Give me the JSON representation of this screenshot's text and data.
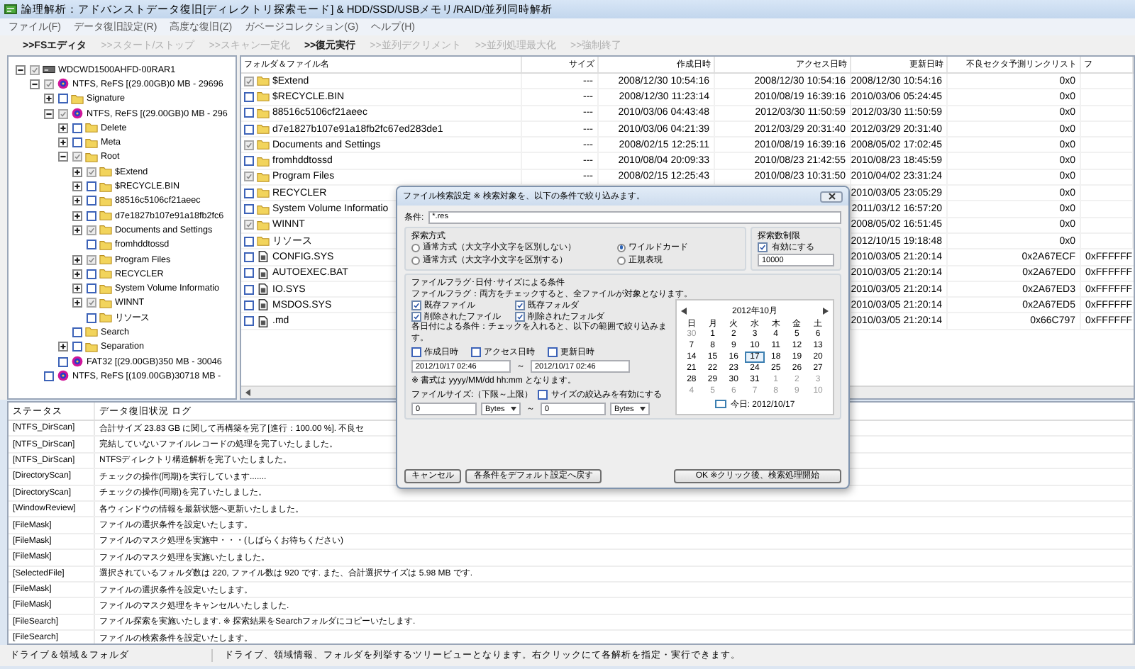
{
  "window": {
    "title": "論理解析：アドバンストデータ復旧[ディレクトリ探索モード] & HDD/SSD/USBメモリ/RAID/並列同時解析"
  },
  "menu": [
    "ファイル(F)",
    "データ復旧設定(R)",
    "高度な復旧(Z)",
    "ガベージコレクション(G)",
    "ヘルプ(H)"
  ],
  "toolbar": [
    {
      "label": ">>FSエディタ",
      "disabled": false
    },
    {
      "label": ">>スタート/ストップ",
      "disabled": true
    },
    {
      "label": ">>スキャン一定化",
      "disabled": true
    },
    {
      "label": ">>復元実行",
      "disabled": false
    },
    {
      "label": ">>並列デクリメント",
      "disabled": true
    },
    {
      "label": ">>並列処理最大化",
      "disabled": true
    },
    {
      "label": ">>強制終了",
      "disabled": true
    }
  ],
  "tree": [
    {
      "label": "WDCWD1500AHFD-00RAR1",
      "kind": "disk",
      "checked": true,
      "expandable": true,
      "expanded": true,
      "children": [
        {
          "label": "NTFS, ReFS [(29.00GB)0 MB - 29696",
          "kind": "partition",
          "checked": true,
          "expandable": true,
          "expanded": true,
          "children": [
            {
              "label": "Signature",
              "kind": "folder",
              "checked": false,
              "expandable": true,
              "expanded": false
            },
            {
              "label": "NTFS, ReFS [(29.00GB)0 MB - 296",
              "kind": "partition",
              "checked": true,
              "expandable": true,
              "expanded": true,
              "children": [
                {
                  "label": "Delete",
                  "kind": "folder",
                  "checked": false,
                  "expandable": true,
                  "expanded": false
                },
                {
                  "label": "Meta",
                  "kind": "folder",
                  "checked": false,
                  "expandable": true,
                  "expanded": false
                },
                {
                  "label": "Root",
                  "kind": "folder",
                  "checked": true,
                  "expandable": true,
                  "expanded": true,
                  "children": [
                    {
                      "label": "$Extend",
                      "kind": "folder",
                      "checked": true,
                      "expandable": true,
                      "expanded": false
                    },
                    {
                      "label": "$RECYCLE.BIN",
                      "kind": "folder",
                      "checked": false,
                      "expandable": true,
                      "expanded": false
                    },
                    {
                      "label": "88516c5106cf21aeec",
                      "kind": "folder",
                      "checked": false,
                      "expandable": true,
                      "expanded": false
                    },
                    {
                      "label": "d7e1827b107e91a18fb2fc6",
                      "kind": "folder",
                      "checked": false,
                      "expandable": true,
                      "expanded": false
                    },
                    {
                      "label": "Documents and Settings",
                      "kind": "folder",
                      "checked": true,
                      "expandable": true,
                      "expanded": false
                    },
                    {
                      "label": "fromhddtossd",
                      "kind": "folder",
                      "checked": false,
                      "expandable": false
                    },
                    {
                      "label": "Program Files",
                      "kind": "folder",
                      "checked": true,
                      "expandable": true,
                      "expanded": false
                    },
                    {
                      "label": "RECYCLER",
                      "kind": "folder",
                      "checked": false,
                      "expandable": true,
                      "expanded": false
                    },
                    {
                      "label": "System Volume Informatio",
                      "kind": "folder",
                      "checked": false,
                      "expandable": true,
                      "expanded": false
                    },
                    {
                      "label": "WINNT",
                      "kind": "folder",
                      "checked": true,
                      "expandable": true,
                      "expanded": false
                    },
                    {
                      "label": "リソース",
                      "kind": "folder",
                      "checked": false,
                      "expandable": false
                    }
                  ]
                },
                {
                  "label": "Search",
                  "kind": "folder",
                  "checked": false,
                  "expandable": false
                },
                {
                  "label": "Separation",
                  "kind": "folder",
                  "checked": false,
                  "expandable": true,
                  "expanded": false
                }
              ]
            },
            {
              "label": "FAT32 [(29.00GB)350 MB - 30046",
              "kind": "partition",
              "checked": false,
              "expandable": false
            }
          ]
        },
        {
          "label": "NTFS, ReFS [(109.00GB)30718 MB -",
          "kind": "partition",
          "checked": false,
          "expandable": false
        }
      ]
    }
  ],
  "file_list": {
    "columns": [
      "フォルダ＆ファイル名",
      "サイズ",
      "作成日時",
      "アクセス日時",
      "更新日時",
      "不良セクタ予測リンクリスト",
      "フ"
    ],
    "rows": [
      {
        "kind": "folder",
        "checked": true,
        "name": "$Extend",
        "size": "---",
        "created": "2008/12/30 10:54:16",
        "accessed": "2008/12/30 10:54:16",
        "modified": "2008/12/30 10:54:16",
        "link_list": "0x0"
      },
      {
        "kind": "folder",
        "checked": false,
        "name": "$RECYCLE.BIN",
        "size": "---",
        "created": "2008/12/30 11:23:14",
        "accessed": "2010/08/19 16:39:16",
        "modified": "2010/03/06 05:24:45",
        "link_list": "0x0"
      },
      {
        "kind": "folder",
        "checked": false,
        "name": "88516c5106cf21aeec",
        "size": "---",
        "created": "2010/03/06 04:43:48",
        "accessed": "2012/03/30 11:50:59",
        "modified": "2012/03/30 11:50:59",
        "link_list": "0x0"
      },
      {
        "kind": "folder",
        "checked": false,
        "name": "d7e1827b107e91a18fb2fc67ed283de1",
        "size": "---",
        "created": "2010/03/06 04:21:39",
        "accessed": "2012/03/29 20:31:40",
        "modified": "2012/03/29 20:31:40",
        "link_list": "0x0"
      },
      {
        "kind": "folder",
        "checked": true,
        "name": "Documents and Settings",
        "size": "---",
        "created": "2008/02/15 12:25:11",
        "accessed": "2010/08/19 16:39:16",
        "modified": "2008/05/02 17:02:45",
        "link_list": "0x0"
      },
      {
        "kind": "folder",
        "checked": false,
        "name": "fromhddtossd",
        "size": "---",
        "created": "2010/08/04 20:09:33",
        "accessed": "2010/08/23 21:42:55",
        "modified": "2010/08/23 18:45:59",
        "link_list": "0x0"
      },
      {
        "kind": "folder",
        "checked": true,
        "name": "Program Files",
        "size": "---",
        "created": "2008/02/15 12:25:43",
        "accessed": "2010/08/23 10:31:50",
        "modified": "2010/04/02 23:31:24",
        "link_list": "0x0"
      },
      {
        "kind": "folder",
        "checked": false,
        "name": "RECYCLER",
        "modified": "2010/03/05 23:05:29",
        "link_list": "0x0"
      },
      {
        "kind": "folder",
        "checked": false,
        "name": "System Volume Informatio",
        "modified": "2011/03/12 16:57:20",
        "link_list": "0x0"
      },
      {
        "kind": "folder",
        "checked": true,
        "name": "WINNT",
        "modified": "2008/05/02 16:51:45",
        "link_list": "0x0"
      },
      {
        "kind": "folder",
        "checked": false,
        "name": "リソース",
        "modified": "2012/10/15 19:18:48",
        "link_list": "0x0"
      },
      {
        "kind": "file",
        "checked": false,
        "name": "CONFIG.SYS",
        "modified": "2010/03/05 21:20:14",
        "link_list": "0x2A67ECF",
        "column_7": "0xFFFFFF"
      },
      {
        "kind": "file",
        "checked": false,
        "name": "AUTOEXEC.BAT",
        "modified": "2010/03/05 21:20:14",
        "link_list": "0x2A67ED0",
        "column_7": "0xFFFFFF"
      },
      {
        "kind": "file",
        "checked": false,
        "name": "IO.SYS",
        "modified": "2010/03/05 21:20:14",
        "link_list": "0x2A67ED3",
        "column_7": "0xFFFFFF"
      },
      {
        "kind": "file",
        "checked": false,
        "name": "MSDOS.SYS",
        "modified": "2010/03/05 21:20:14",
        "link_list": "0x2A67ED5",
        "column_7": "0xFFFFFF"
      },
      {
        "kind": "file",
        "checked": false,
        "name": ".md",
        "modified": "2010/03/05 21:20:14",
        "link_list": "0x66C797",
        "column_7": "0xFFFFFF"
      }
    ]
  },
  "log": {
    "columns": [
      "ステータス",
      "データ復旧状況 ログ"
    ],
    "rows": [
      {
        "status": "[NTFS_DirScan]",
        "message": "合計サイズ 23.83 GB に関して再構築を完了[進行：100.00 %]. 不良セ"
      },
      {
        "status": "[NTFS_DirScan]",
        "message": "完結していないファイルレコードの処理を完了いたしました。"
      },
      {
        "status": "[NTFS_DirScan]",
        "message": "NTFSディレクトリ構造解析を完了いたしました。"
      },
      {
        "status": "[DirectoryScan]",
        "message": "チェックの操作(同期)を実行しています......."
      },
      {
        "status": "[DirectoryScan]",
        "message": "チェックの操作(同期)を完了いたしました。"
      },
      {
        "status": "[WindowReview]",
        "message": "各ウィンドウの情報を最新状態へ更新いたしました。"
      },
      {
        "status": "[FileMask]",
        "message": "ファイルの選択条件を設定いたします。"
      },
      {
        "status": "[FileMask]",
        "message": "ファイルのマスク処理を実施中・・・(しばらくお待ちください)"
      },
      {
        "status": "[FileMask]",
        "message": "ファイルのマスク処理を実施いたしました。"
      },
      {
        "status": "[SelectedFile]",
        "message": "選択されているフォルダ数は 220, ファイル数は 920 です. また、合計選択サイズは 5.98 MB です."
      },
      {
        "status": "[FileMask]",
        "message": "ファイルの選択条件を設定いたします。"
      },
      {
        "status": "[FileMask]",
        "message": "ファイルのマスク処理をキャンセルいたしました."
      },
      {
        "status": "[FileSearch]",
        "message": "ファイル探索を実施いたします. ※ 探索結果をSearchフォルダにコピーいたします."
      },
      {
        "status": "[FileSearch]",
        "message": "ファイルの検索条件を設定いたします。"
      }
    ]
  },
  "status_bar": {
    "section": "ドライブ＆領域＆フォルダ",
    "text": "ドライブ、領域情報、フォルダを列挙するツリービューとなります。右クリックにて各解析を指定・実行できます。"
  },
  "dialog": {
    "title": "ファイル検索設定 ※ 検索対象を、以下の条件で絞り込みます。",
    "condition": {
      "label": "条件:",
      "value": "*.res"
    },
    "search_method": {
      "title": "探索方式",
      "options": [
        {
          "label": "通常方式（大文字小文字を区別しない）",
          "selected": false
        },
        {
          "label": "通常方式（大文字小文字を区別する）",
          "selected": false
        },
        {
          "label": "ワイルドカード",
          "selected": true
        },
        {
          "label": "正規表現",
          "selected": false
        }
      ]
    },
    "limit": {
      "title": "探索数制限",
      "label": "有効にする",
      "checked": true,
      "value": "10000"
    },
    "filters": {
      "title": "ファイルフラグ･日付･サイズによる条件",
      "flag_note": "ファイルフラグ：両方をチェックすると、全ファイルが対象となります。",
      "flags": [
        {
          "label": "既存ファイル",
          "checked": true
        },
        {
          "label": "削除されたファイル",
          "checked": true
        },
        {
          "label": "既存フォルダ",
          "checked": true
        },
        {
          "label": "削除されたフォルダ",
          "checked": true
        }
      ],
      "date_note": "各日付による条件：チェックを入れると、以下の範囲で絞り込みます。",
      "date_types": [
        {
          "label": "作成日時",
          "checked": false
        },
        {
          "label": "アクセス日時",
          "checked": false
        },
        {
          "label": "更新日時",
          "checked": false
        }
      ],
      "date_from": "2012/10/17 02:46",
      "date_separator": "～",
      "date_to": "2012/10/17 02:46",
      "format_note": "※ 書式は yyyy/MM/dd hh:mm となります。",
      "size_label": "ファイルサイズ:（下限～上限）",
      "size_enable": {
        "label": "サイズの絞込みを有効にする",
        "checked": false
      },
      "size_from": {
        "value": "0",
        "unit": "Bytes"
      },
      "size_separator": "～",
      "size_to": {
        "value": "0",
        "unit": "Bytes"
      }
    },
    "calendar": {
      "month": "2012年10月",
      "weekdays": [
        "日",
        "月",
        "火",
        "水",
        "木",
        "金",
        "土"
      ],
      "days": [
        {
          "day": "30",
          "other_month": true,
          "selected": false
        },
        {
          "day": "1",
          "other_month": false,
          "selected": false
        },
        {
          "day": "2",
          "other_month": false,
          "selected": false
        },
        {
          "day": "3",
          "other_month": false,
          "selected": false
        },
        {
          "day": "4",
          "other_month": false,
          "selected": false
        },
        {
          "day": "5",
          "other_month": false,
          "selected": false
        },
        {
          "day": "6",
          "other_month": false,
          "selected": false
        },
        {
          "day": "7",
          "other_month": false,
          "selected": false
        },
        {
          "day": "8",
          "other_month": false,
          "selected": false
        },
        {
          "day": "9",
          "other_month": false,
          "selected": false
        },
        {
          "day": "10",
          "other_month": false,
          "selected": false
        },
        {
          "day": "11",
          "other_month": false,
          "selected": false
        },
        {
          "day": "12",
          "other_month": false,
          "selected": false
        },
        {
          "day": "13",
          "other_month": false,
          "selected": false
        },
        {
          "day": "14",
          "other_month": false,
          "selected": false
        },
        {
          "day": "15",
          "other_month": false,
          "selected": false
        },
        {
          "day": "16",
          "other_month": false,
          "selected": false
        },
        {
          "day": "17",
          "other_month": false,
          "selected": true
        },
        {
          "day": "18",
          "other_month": false,
          "selected": false
        },
        {
          "day": "19",
          "other_month": false,
          "selected": false
        },
        {
          "day": "20",
          "other_month": false,
          "selected": false
        },
        {
          "day": "21",
          "other_month": false,
          "selected": false
        },
        {
          "day": "22",
          "other_month": false,
          "selected": false
        },
        {
          "day": "23",
          "other_month": false,
          "selected": false
        },
        {
          "day": "24",
          "other_month": false,
          "selected": false
        },
        {
          "day": "25",
          "other_month": false,
          "selected": false
        },
        {
          "day": "26",
          "other_month": false,
          "selected": false
        },
        {
          "day": "27",
          "other_month": false,
          "selected": false
        },
        {
          "day": "28",
          "other_month": false,
          "selected": false
        },
        {
          "day": "29",
          "other_month": false,
          "selected": false
        },
        {
          "day": "30",
          "other_month": false,
          "selected": false
        },
        {
          "day": "31",
          "other_month": false,
          "selected": false
        },
        {
          "day": "1",
          "other_month": true,
          "selected": false
        },
        {
          "day": "2",
          "other_month": true,
          "selected": false
        },
        {
          "day": "3",
          "other_month": true,
          "selected": false
        },
        {
          "day": "4",
          "other_month": true,
          "selected": false
        },
        {
          "day": "5",
          "other_month": true,
          "selected": false
        },
        {
          "day": "6",
          "other_month": true,
          "selected": false
        },
        {
          "day": "7",
          "other_month": true,
          "selected": false
        },
        {
          "day": "8",
          "other_month": true,
          "selected": false
        },
        {
          "day": "9",
          "other_month": true,
          "selected": false
        },
        {
          "day": "10",
          "other_month": true,
          "selected": false
        }
      ],
      "today": "今日: 2012/10/17"
    },
    "buttons": [
      "キャンセル",
      "各条件をデフォルト設定へ戻す",
      "OK ※クリック後、検索処理開始"
    ]
  }
}
